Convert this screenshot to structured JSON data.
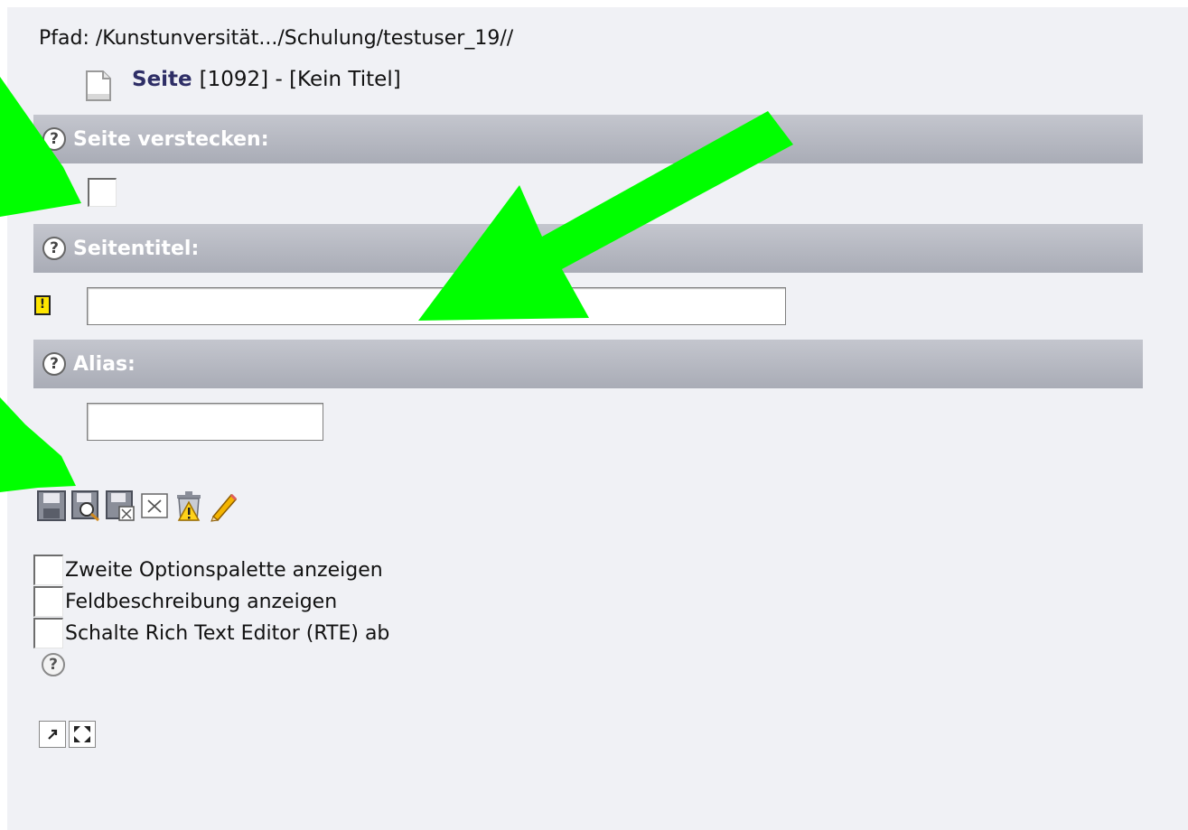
{
  "path": {
    "label": "Pfad:",
    "value": "/Kunstunversität.../Schulung/testuser_19//"
  },
  "record": {
    "type": "Seite",
    "id": "[1092]",
    "separator": "-",
    "title": "[Kein Titel]",
    "icon": "page-document-icon"
  },
  "sections": {
    "hide": {
      "label": "Seite verstecken:",
      "checked": false
    },
    "title": {
      "label": "Seitentitel:",
      "value": "",
      "required_icon": "required-warning-icon",
      "required_mark": "!"
    },
    "alias": {
      "label": "Alias:",
      "value": ""
    }
  },
  "help_glyph": "?",
  "toolbar": {
    "icons": [
      "save-icon",
      "save-and-view-icon",
      "save-and-close-icon",
      "close-icon",
      "delete-icon",
      "edit-pencil-icon"
    ]
  },
  "options": [
    {
      "label": "Zweite Optionspalette anzeigen",
      "checked": false
    },
    {
      "label": "Feldbeschreibung anzeigen",
      "checked": false
    },
    {
      "label": "Schalte Rich Text Editor (RTE) ab",
      "checked": false
    }
  ],
  "bottom_buttons": [
    "open-new-window-icon",
    "fullscreen-icon"
  ],
  "annotation_color": "#00ff00"
}
